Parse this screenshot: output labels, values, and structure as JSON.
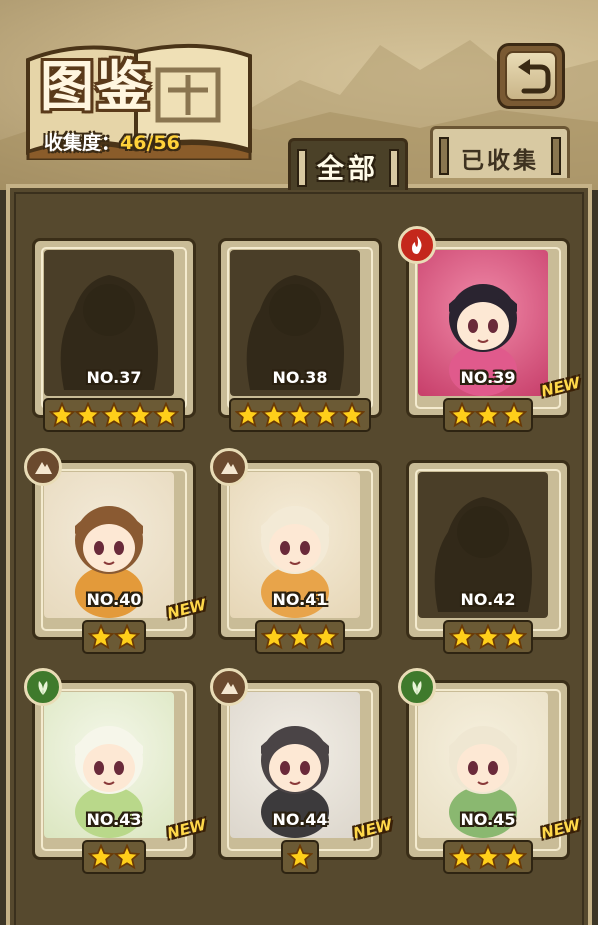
{
  "header": {
    "title": "图鉴",
    "collect_label": "收集度：",
    "collect_value": "46/56"
  },
  "tabs": [
    {
      "label": "全部",
      "active": true
    },
    {
      "label": "已收集",
      "active": false
    }
  ],
  "colors": {
    "fire": "#c4281c",
    "earth": "#6b4a2e",
    "grass": "#3f7a2c",
    "star": "#ffcf1a",
    "new": "#ffd84a"
  },
  "cards": [
    {
      "number": "NO.37",
      "stars": 5,
      "locked": true,
      "element": null,
      "is_new": false
    },
    {
      "number": "NO.38",
      "stars": 5,
      "locked": true,
      "element": null,
      "is_new": false
    },
    {
      "number": "NO.39",
      "stars": 3,
      "locked": false,
      "element": "fire",
      "is_new": true,
      "new_label": "NEW"
    },
    {
      "number": "NO.40",
      "stars": 2,
      "locked": false,
      "element": "earth",
      "is_new": true,
      "new_label": "NEW"
    },
    {
      "number": "NO.41",
      "stars": 3,
      "locked": false,
      "element": "earth",
      "is_new": false
    },
    {
      "number": "NO.42",
      "stars": 3,
      "locked": true,
      "element": null,
      "is_new": false
    },
    {
      "number": "NO.43",
      "stars": 2,
      "locked": false,
      "element": "grass",
      "is_new": true,
      "new_label": "NEW"
    },
    {
      "number": "NO.44",
      "stars": 1,
      "locked": false,
      "element": "earth",
      "is_new": true,
      "new_label": "NEW"
    },
    {
      "number": "NO.45",
      "stars": 3,
      "locked": false,
      "element": "grass",
      "is_new": true,
      "new_label": "NEW"
    }
  ]
}
